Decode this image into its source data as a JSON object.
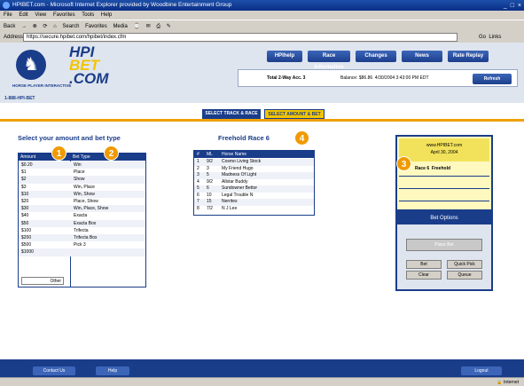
{
  "window": {
    "title": "HPIBET.com - Microsoft Internet Explorer provided by Woodbine Entertainment Group",
    "controls": "_ □ ×"
  },
  "menu": [
    "File",
    "Edit",
    "View",
    "Favorites",
    "Tools",
    "Help"
  ],
  "toolbar": [
    "Back",
    "→",
    "⊗",
    "⟳",
    "⌂",
    "Search",
    "Favorites",
    "Media",
    "⌚",
    "✉",
    "⎙",
    "✎"
  ],
  "address": {
    "label": "Address",
    "value": "https://secure.hpibet.com/hpibet/index.cfm",
    "go": "Go",
    "links": "Links"
  },
  "brand": {
    "name_line1": "HPI",
    "name_line2": "BET",
    "name_line3": ".COM",
    "small": "HORSE PLAYER INTERACTIVE",
    "phone": "1-888-HPI-BET"
  },
  "topnav": [
    "HPIhelp",
    "Race Information",
    "Changes",
    "News",
    "Rate Replay"
  ],
  "account": {
    "label": "Total 2-Way Acc. 3",
    "balance": "Balance: $86.86",
    "date": "4/30/2004  3:43:00 PM EDT",
    "refresh": "Refresh"
  },
  "steps": [
    "SELECT TRACK & RACE",
    "SELECT AMOUNT & BET"
  ],
  "amount_section": {
    "title": "Select your amount and bet type",
    "col_amount": "Amount",
    "col_bettype": "Bet Type",
    "rows": [
      {
        "amount": "$0.20",
        "type": "Win"
      },
      {
        "amount": "$1",
        "type": "Place"
      },
      {
        "amount": "$2",
        "type": "Show"
      },
      {
        "amount": "$3",
        "type": "Win, Place"
      },
      {
        "amount": "$10",
        "type": "Win, Show"
      },
      {
        "amount": "$20",
        "type": "Place, Show"
      },
      {
        "amount": "$30",
        "type": "Win, Place, Show"
      },
      {
        "amount": "$40",
        "type": "Exacta"
      },
      {
        "amount": "$50",
        "type": "Exacta Box"
      },
      {
        "amount": "$100",
        "type": "Trifecta"
      },
      {
        "amount": "$200",
        "type": "Trifecta Box"
      },
      {
        "amount": "$500",
        "type": "Pick 3"
      },
      {
        "amount": "$1000",
        "type": ""
      }
    ],
    "other_label": "Other"
  },
  "race_section": {
    "title": "Freehold Race 6",
    "col_num": "#",
    "col_odds": "ML",
    "col_horse": "Horse Name",
    "rows": [
      {
        "num": "1",
        "odds": "9/2",
        "horse": "Cosmo Living Stock"
      },
      {
        "num": "2",
        "odds": "3",
        "horse": "My Friend Hugo"
      },
      {
        "num": "3",
        "odds": "5",
        "horse": "Madness Of Light"
      },
      {
        "num": "4",
        "odds": "9/2",
        "horse": "Allstar Buddy"
      },
      {
        "num": "5",
        "odds": "6",
        "horse": "Sundowner Bettor"
      },
      {
        "num": "6",
        "odds": "10",
        "horse": "Legal Trouble N"
      },
      {
        "num": "7",
        "odds": "15",
        "horse": "Nerrites"
      },
      {
        "num": "8",
        "odds": "7/2",
        "horse": "N J Lee"
      }
    ]
  },
  "ticket": {
    "site": "www.HPIBET.com",
    "date": "April 30, 2004",
    "race_line": "Race 6",
    "track": "Freehold"
  },
  "bet_options": {
    "title": "Bet Options",
    "place_bet": "Place Bet",
    "bet": "Bet",
    "quick_pick": "Quick Pick",
    "clear": "Clear",
    "queue": "Queue"
  },
  "bottom": {
    "contact": "Contact Us",
    "help": "Help",
    "logout": "Logout"
  },
  "status": {
    "zone": "Internet"
  },
  "badges": [
    "1",
    "2",
    "3",
    "4"
  ],
  "colors": {
    "brand_blue": "#1a3d8a",
    "brand_yellow": "#f2c500",
    "badge_orange": "#f09a00"
  }
}
